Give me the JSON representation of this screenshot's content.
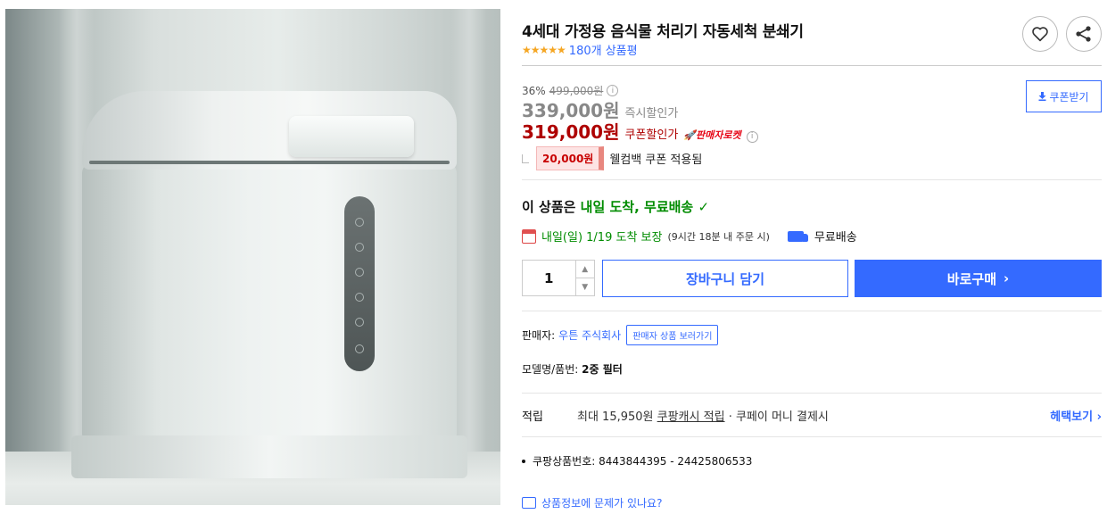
{
  "product": {
    "title": "4세대 가정용 음식물 처리기 자동세척 분쇄기",
    "stars": "★★★★★",
    "review_count": "180개 상품평"
  },
  "price": {
    "discount_rate": "36%",
    "original": "499,000원",
    "instant_price": "339,000원",
    "instant_label": "즉시할인가",
    "coupon_price": "319,000원",
    "coupon_label": "쿠폰할인가",
    "rocket_badge": "판매자로켓",
    "coupon_button": "쿠폰받기",
    "cashback_amount": "20,000원",
    "cashback_text": "웰컴백 쿠폰 적용됨"
  },
  "shipping": {
    "head_prefix": "이 상품은",
    "head_highlight": "내일 도착, 무료배송",
    "arrival": "내일(일) 1/19 도착 보장",
    "arrival_note": "(9시간 18분 내 주문 시)",
    "free_shipping": "무료배송"
  },
  "purchase": {
    "quantity": "1",
    "cart_button": "장바구니 담기",
    "buy_button": "바로구매"
  },
  "seller": {
    "label": "판매자:",
    "name": "우튼 주식회사",
    "chip": "판매자 상품 보러가기"
  },
  "model": {
    "label": "모델명/품번:",
    "value": "2중 필터"
  },
  "points": {
    "label": "적립",
    "prefix": "최대 15,950원",
    "link": "쿠팡캐시 적립",
    "suffix": "· 쿠페이 머니 결제시",
    "more": "헤택보기"
  },
  "product_number": "쿠팡상품번호: 8443844395 - 24425806533",
  "report_link": "상품정보에 문제가 있나요?",
  "colors": {
    "accent_blue": "#346aff",
    "price_red": "#ae0000",
    "green": "#008c00",
    "star": "#f5a623"
  }
}
